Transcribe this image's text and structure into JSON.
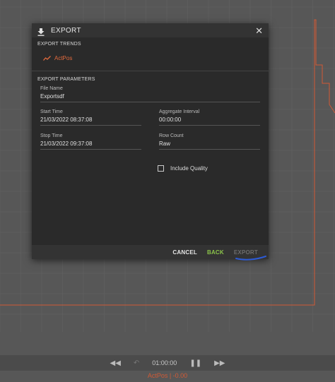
{
  "dialog": {
    "title": "EXPORT",
    "close_glyph": "✕",
    "trends_section": {
      "heading": "EXPORT TRENDS",
      "trends": [
        {
          "name": "ActPos",
          "icon": "trend-line-icon"
        }
      ]
    },
    "params_section": {
      "heading": "EXPORT PARAMETERS",
      "file_name": {
        "label": "File Name",
        "value": "Exportsdf"
      },
      "start_time": {
        "label": "Start Time",
        "value": "21/03/2022 08:37:08"
      },
      "aggregate_interval": {
        "label": "Aggregate Interval",
        "value": "00:00:00"
      },
      "stop_time": {
        "label": "Stop Time",
        "value": "21/03/2022 09:37:08"
      },
      "row_count": {
        "label": "Row Count",
        "value": "Raw"
      },
      "include_quality": {
        "label": "Include Quality",
        "checked": false
      }
    },
    "footer": {
      "cancel_label": "CANCEL",
      "back_label": "BACK",
      "export_label": "EXPORT"
    }
  },
  "playback": {
    "rewind_glyph": "◀◀",
    "undo_glyph": "↶",
    "duration": "01:00:00",
    "pause_glyph": "❚❚",
    "forward_glyph": "▶▶"
  },
  "trend_legend": "ActPos | -0.00",
  "colors": {
    "accent_trend": "#e26a3d",
    "back_green": "#8bc34a",
    "annotation_blue": "#2d5bd6",
    "dialog_bg": "#2a2a2a",
    "page_bg": "#575757"
  }
}
